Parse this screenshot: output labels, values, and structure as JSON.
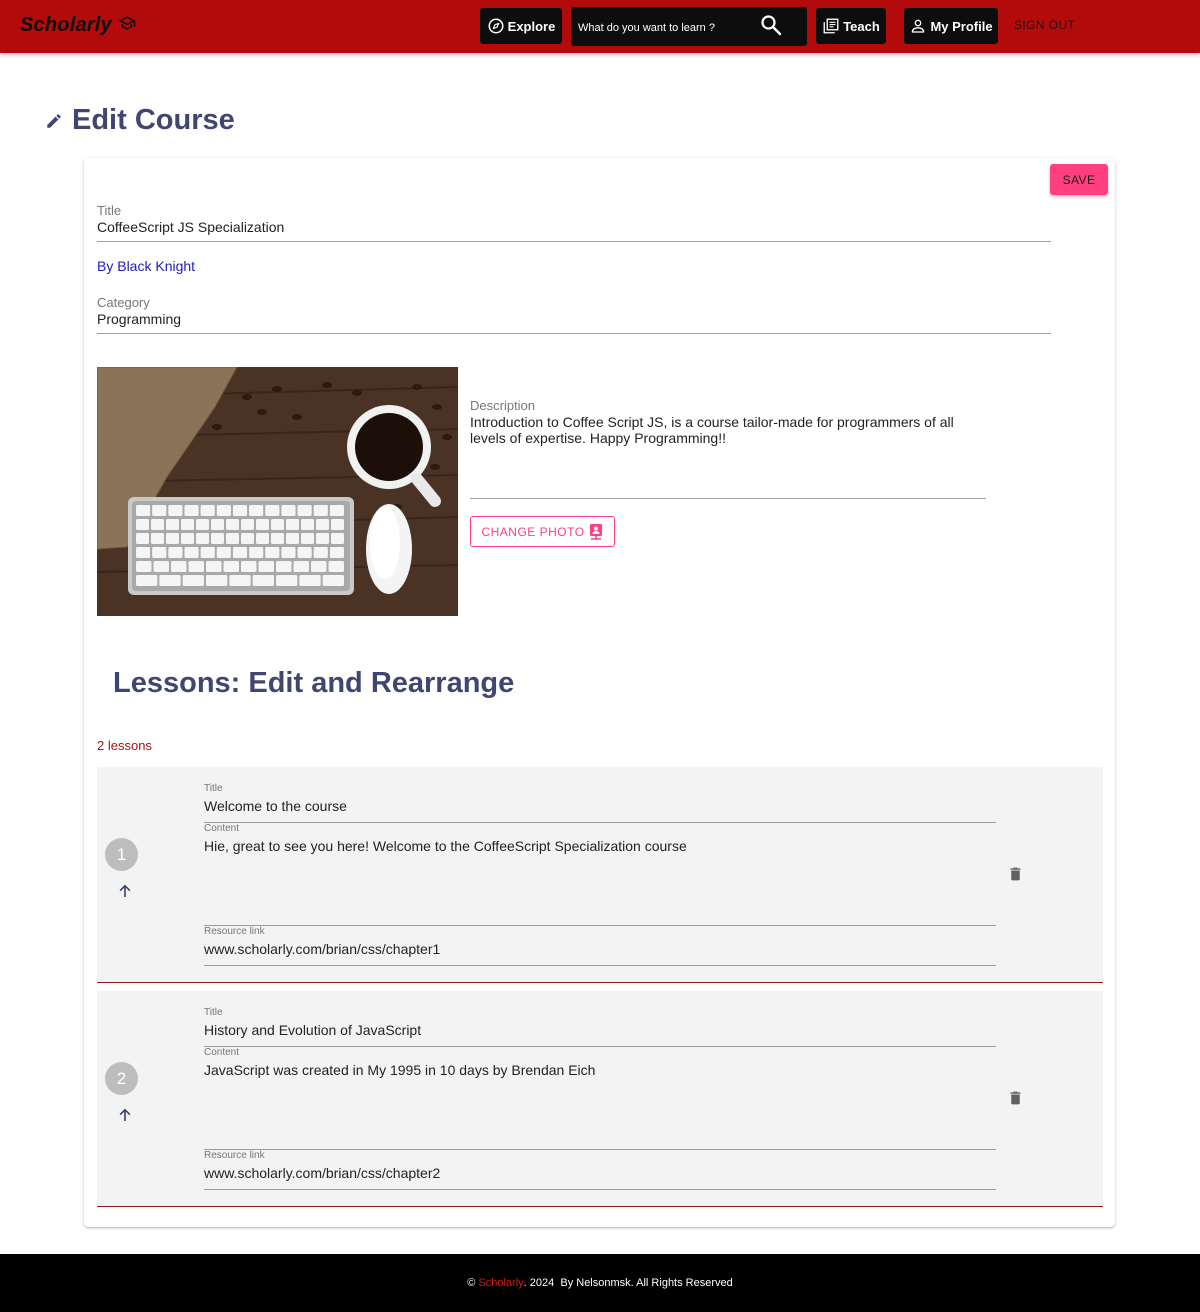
{
  "header": {
    "brand": "Scholarly",
    "explore_label": "Explore",
    "search_placeholder": "What do you want to learn ?",
    "teach_label": "Teach",
    "profile_label": "My Profile",
    "signout_label": "SIGN OUT",
    "bar_color": "#b30b0b"
  },
  "page": {
    "title": "Edit Course",
    "save_label": "SAVE"
  },
  "course": {
    "title_label": "Title",
    "title_value": "CoffeeScript JS Specialization",
    "author": "By Black Knight",
    "category_label": "Category",
    "category_value": "Programming",
    "description_label": "Description",
    "description_value": "Introduction to Coffee Script JS, is a course tailor-made for programmers of all levels of expertise. Happy Programming!!",
    "change_photo_label": "CHANGE PHOTO",
    "accent_color": "#ff3f80"
  },
  "lessons": {
    "heading": "Lessons: Edit and Rearrange",
    "count_text": "2 lessons",
    "items": [
      {
        "number": "1",
        "title_label": "Title",
        "title": "Welcome to the course",
        "content_label": "Content",
        "content": "Hie, great to see you here! Welcome to the CoffeeScript Specialization course",
        "resource_label": "Resource link",
        "resource": "www.scholarly.com/brian/css/chapter1"
      },
      {
        "number": "2",
        "title_label": "Title",
        "title": "History and Evolution of JavaScript",
        "content_label": "Content",
        "content": "JavaScript was created in My 1995 in 10 days by Brendan Eich",
        "resource_label": "Resource link",
        "resource": "www.scholarly.com/brian/css/chapter2"
      }
    ]
  },
  "footer": {
    "copyright": "©",
    "brand": "Scholarly",
    "rest": ". 2024  By Nelsonmsk. All Rights Reserved"
  }
}
